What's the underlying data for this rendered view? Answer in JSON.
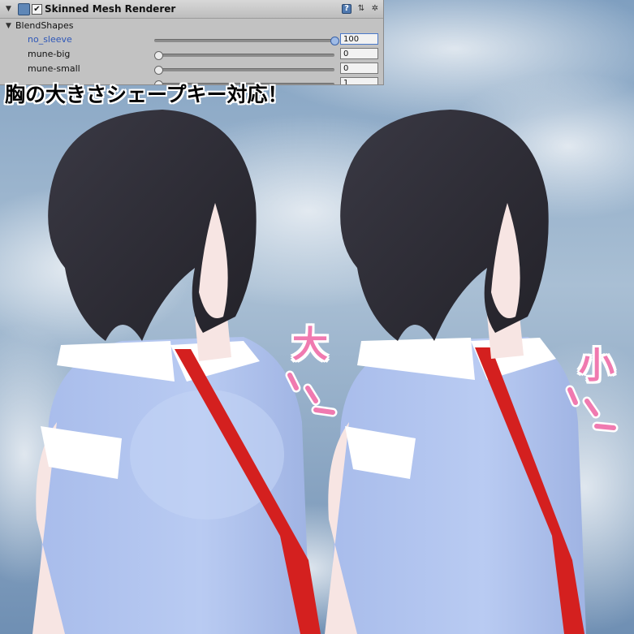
{
  "inspector": {
    "component_title": "Skinned Mesh Renderer",
    "component_enabled_mark": "✔",
    "fold_arrow": "▼",
    "help_icon": "?",
    "preset_icon": "⇅",
    "gear_icon": "✲",
    "blendshapes_label": "BlendShapes",
    "shapes": [
      {
        "name": "no_sleeve",
        "value": "100",
        "fraction": 1.0,
        "selected": true
      },
      {
        "name": "mune-big",
        "value": "0",
        "fraction": 0.0,
        "selected": false
      },
      {
        "name": "mune-small",
        "value": "0",
        "fraction": 0.0,
        "selected": false
      },
      {
        "name": "",
        "value": "1",
        "fraction": 0.0,
        "selected": false
      }
    ]
  },
  "overlay": {
    "caption": "胸の大きさシェープキー対応！",
    "big_label": "大",
    "small_label": "小",
    "accent_color": "#f07ab0"
  },
  "colors": {
    "sky_top": "#7f9fc0",
    "sky_light": "#c9d6e4",
    "hair": "#2d2c35",
    "shirt": "#b3c5ee",
    "collar": "#ffffff",
    "tie": "#d4201f",
    "skin": "#f7e5e3"
  }
}
